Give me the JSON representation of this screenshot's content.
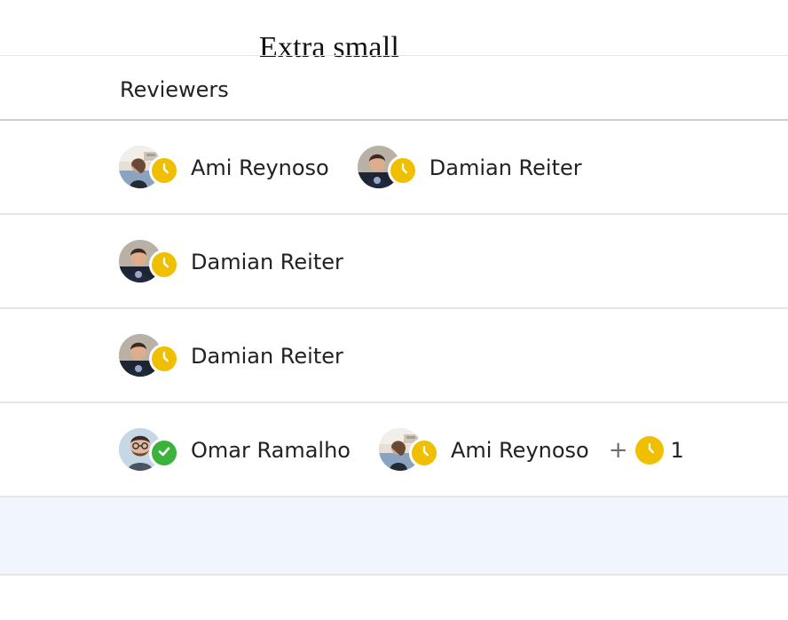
{
  "caption": "Extra small",
  "table": {
    "header": "Reviewers",
    "rows": [
      {
        "reviewers": [
          {
            "name": "Ami Reynoso",
            "status": "pending",
            "avatar": "ami"
          },
          {
            "name": "Damian Reiter",
            "status": "pending",
            "avatar": "damian"
          }
        ]
      },
      {
        "reviewers": [
          {
            "name": "Damian Reiter",
            "status": "pending",
            "avatar": "damian"
          }
        ]
      },
      {
        "reviewers": [
          {
            "name": "Damian Reiter",
            "status": "pending",
            "avatar": "damian"
          }
        ]
      },
      {
        "reviewers": [
          {
            "name": "Omar Ramalho",
            "status": "approved",
            "avatar": "omar"
          },
          {
            "name": "Ami Reynoso",
            "status": "pending",
            "avatar": "ami"
          }
        ],
        "extra": {
          "plus": "+",
          "count": "1",
          "status": "pending"
        }
      }
    ]
  },
  "icons": {
    "pending": "clock-icon",
    "approved": "check-icon"
  },
  "colors": {
    "pending": "#f0c000",
    "approved": "#3bb23b",
    "selected_row": "#f1f5fd"
  }
}
